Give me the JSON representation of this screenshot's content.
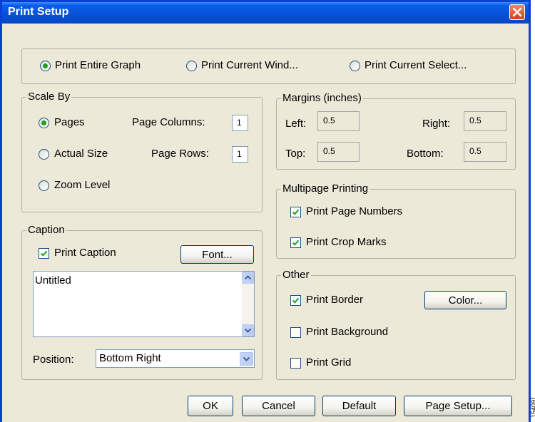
{
  "title": "Print Setup",
  "print_range": {
    "options": [
      "Print Entire Graph",
      "Print Current Wind...",
      "Print Current Select..."
    ],
    "selected": 0
  },
  "scale_by": {
    "legend": "Scale By",
    "pages": "Pages",
    "actual_size": "Actual Size",
    "zoom_level": "Zoom Level",
    "page_columns_label": "Page Columns:",
    "page_columns_value": "1",
    "page_rows_label": "Page Rows:",
    "page_rows_value": "1"
  },
  "margins": {
    "legend": "Margins (inches)",
    "left_label": "Left:",
    "left_value": "0.5",
    "right_label": "Right:",
    "right_value": "0.5",
    "top_label": "Top:",
    "top_value": "0.5",
    "bottom_label": "Bottom:",
    "bottom_value": "0.5"
  },
  "multipage": {
    "legend": "Multipage Printing",
    "page_numbers": "Print Page Numbers",
    "crop_marks": "Print Crop Marks"
  },
  "caption": {
    "legend": "Caption",
    "print_caption": "Print Caption",
    "font_button": "Font...",
    "text": "Untitled",
    "position_label": "Position:",
    "position_value": "Bottom Right"
  },
  "other": {
    "legend": "Other",
    "print_border": "Print Border",
    "color_button": "Color...",
    "print_background": "Print Background",
    "print_grid": "Print Grid"
  },
  "buttons": {
    "ok": "OK",
    "cancel": "Cancel",
    "default": "Default",
    "page_setup": "Page Setup..."
  },
  "side_text": "154091"
}
